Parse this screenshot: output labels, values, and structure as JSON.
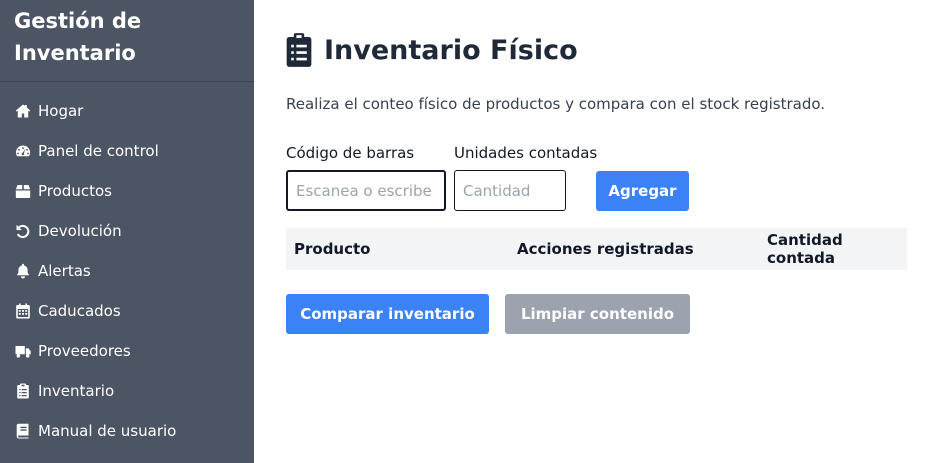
{
  "sidebar": {
    "title_line1": "Gestión de",
    "title_line2": "Inventario",
    "items": [
      {
        "label": "Hogar",
        "icon": "home-icon"
      },
      {
        "label": "Panel de control",
        "icon": "gauge-icon"
      },
      {
        "label": "Productos",
        "icon": "box-icon"
      },
      {
        "label": "Devolución",
        "icon": "undo-icon"
      },
      {
        "label": "Alertas",
        "icon": "bell-icon"
      },
      {
        "label": "Caducados",
        "icon": "calendar-icon"
      },
      {
        "label": "Proveedores",
        "icon": "truck-icon"
      },
      {
        "label": "Inventario",
        "icon": "clipboard-icon"
      },
      {
        "label": "Manual de usuario",
        "icon": "book-icon"
      }
    ]
  },
  "main": {
    "title": "Inventario Físico",
    "title_icon": "clipboard-list-icon",
    "subtitle": "Realiza el conteo físico de productos y compara con el stock registrado.",
    "barcode": {
      "label": "Código de barras",
      "value": "",
      "placeholder": "Escanea o escribe"
    },
    "quantity": {
      "label": "Unidades contadas",
      "value": "",
      "placeholder": "Cantidad"
    },
    "add_button": "Agregar",
    "table": {
      "columns": [
        "Producto",
        "Acciones registradas",
        "Cantidad contada"
      ],
      "rows": []
    },
    "compare_button": "Comparar inventario",
    "clear_button": "Limpiar contenido"
  },
  "colors": {
    "sidebar_bg": "#4b5563",
    "primary": "#3b82f6",
    "secondary": "#9ca3af",
    "table_header_bg": "#f3f4f6"
  }
}
